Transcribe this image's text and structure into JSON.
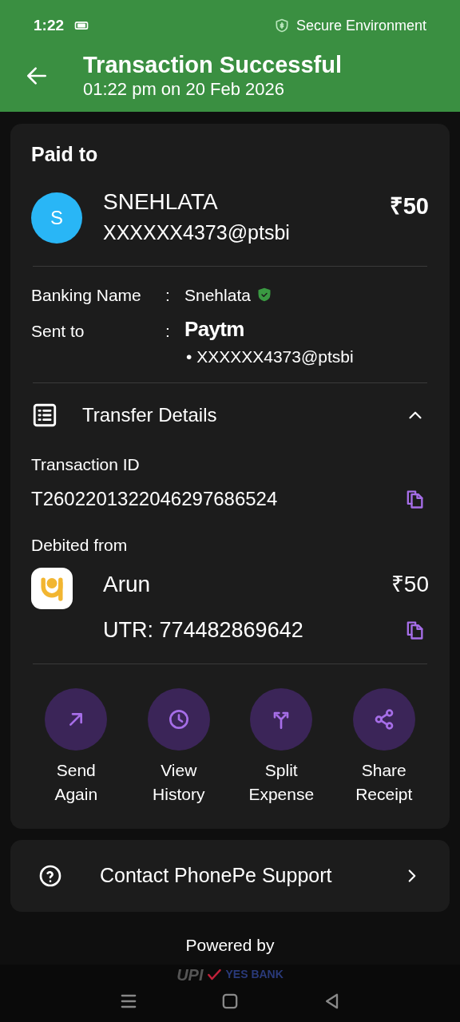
{
  "status_bar": {
    "time": "1:22",
    "secure_label": "Secure Environment"
  },
  "header": {
    "title": "Transaction Successful",
    "subtitle": "01:22 pm on 20 Feb 2026"
  },
  "paid_to": {
    "heading": "Paid to",
    "avatar_letter": "S",
    "name": "SNEHLATA",
    "upi_id": "XXXXXX4373@ptsbi",
    "amount": "₹50"
  },
  "details": [
    {
      "label": "Banking Name",
      "separator": ":",
      "value": "Snehlata",
      "verified": true
    },
    {
      "label": "Sent to",
      "separator": ":",
      "logo_text": "Paytm",
      "value": "• XXXXXX4373@ptsbi",
      "verified": false
    }
  ],
  "transfer": {
    "title": "Transfer Details",
    "expanded": true,
    "transaction_id_label": "Transaction ID",
    "transaction_id": "T2602201322046297686524",
    "debited_label": "Debited from",
    "account_name": "Arun",
    "amount": "₹50",
    "utr": "UTR: 774482869642"
  },
  "actions": [
    {
      "kind": "send",
      "label": "Send Again"
    },
    {
      "kind": "history",
      "label": "View History"
    },
    {
      "kind": "split",
      "label": "Split Expense"
    },
    {
      "kind": "share",
      "label": "Share Receipt"
    }
  ],
  "support": {
    "label": "Contact PhonePe Support"
  },
  "footer": {
    "powered_by": "Powered by",
    "upi_logo": "UPI",
    "bank_logo": "YES BANK"
  }
}
